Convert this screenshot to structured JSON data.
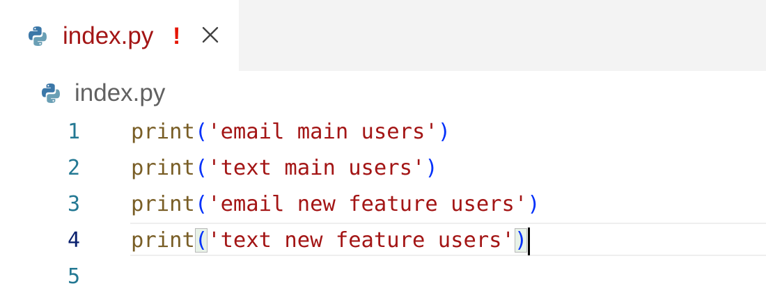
{
  "tab": {
    "filename": "index.py",
    "status_marker": "!",
    "close_icon": "close-icon",
    "file_icon": "python-icon"
  },
  "breadcrumb": {
    "filename": "index.py",
    "file_icon": "python-icon"
  },
  "editor": {
    "current_line": 4,
    "lines": [
      {
        "number": "1",
        "fn": "print",
        "open": "(",
        "str": "'email main users'",
        "close": ")"
      },
      {
        "number": "2",
        "fn": "print",
        "open": "(",
        "str": "'text main users'",
        "close": ")"
      },
      {
        "number": "3",
        "fn": "print",
        "open": "(",
        "str": "'email new feature users'",
        "close": ")"
      },
      {
        "number": "4",
        "fn": "print",
        "open": "(",
        "str": "'text new feature users'",
        "close": ")"
      },
      {
        "number": "5",
        "fn": "",
        "open": "",
        "str": "",
        "close": ""
      }
    ]
  },
  "colors": {
    "tab_label": "#a31515",
    "status_marker": "#e51400",
    "function": "#795e26",
    "string": "#a31515",
    "bracket": "#0431fa",
    "line_number": "#237893",
    "line_number_active": "#0b216f"
  }
}
